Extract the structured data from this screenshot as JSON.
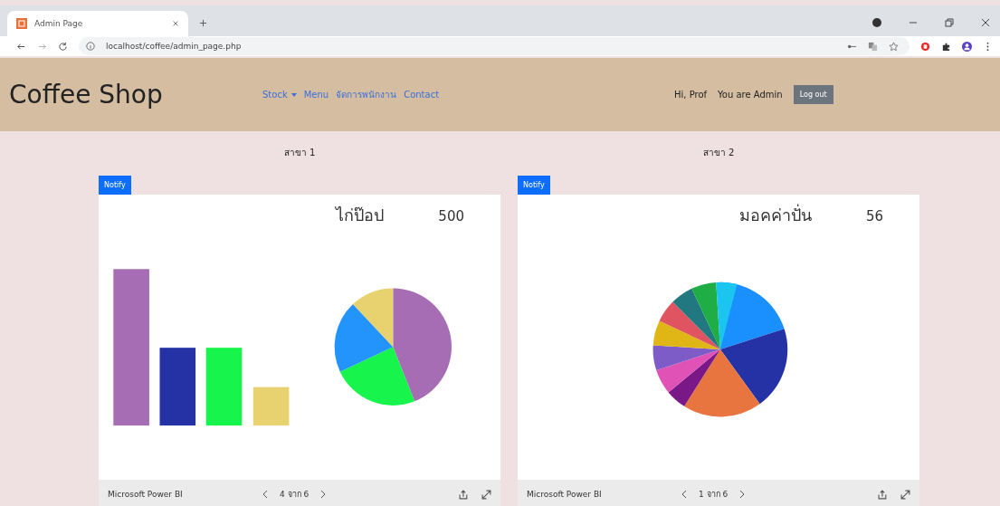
{
  "browser": {
    "tab_title": "Admin Page",
    "url": "localhost/coffee/admin_page.php"
  },
  "navbar": {
    "brand": "Coffee Shop",
    "links": [
      {
        "label": "Stock",
        "dropdown": true
      },
      {
        "label": "Menu",
        "dropdown": false
      },
      {
        "label": "จัดการพนักงาน",
        "dropdown": false
      },
      {
        "label": "Contact",
        "dropdown": false
      }
    ],
    "greeting": "Hi, Prof",
    "role": "You are Admin",
    "logout": "Log out"
  },
  "branches": [
    {
      "label": "สาขา 1",
      "notify": "Notify",
      "kind": "bar_pie",
      "title": "ไก่ป๊อป",
      "value": "500",
      "footer_brand": "Microsoft Power BI",
      "pager": "4 จาก 6"
    },
    {
      "label": "สาขา 2",
      "notify": "Notify",
      "kind": "pie",
      "title": "มอคค่าปั่น",
      "value": "56",
      "footer_brand": "Microsoft Power BI",
      "pager": "1 จาก 6"
    }
  ]
}
